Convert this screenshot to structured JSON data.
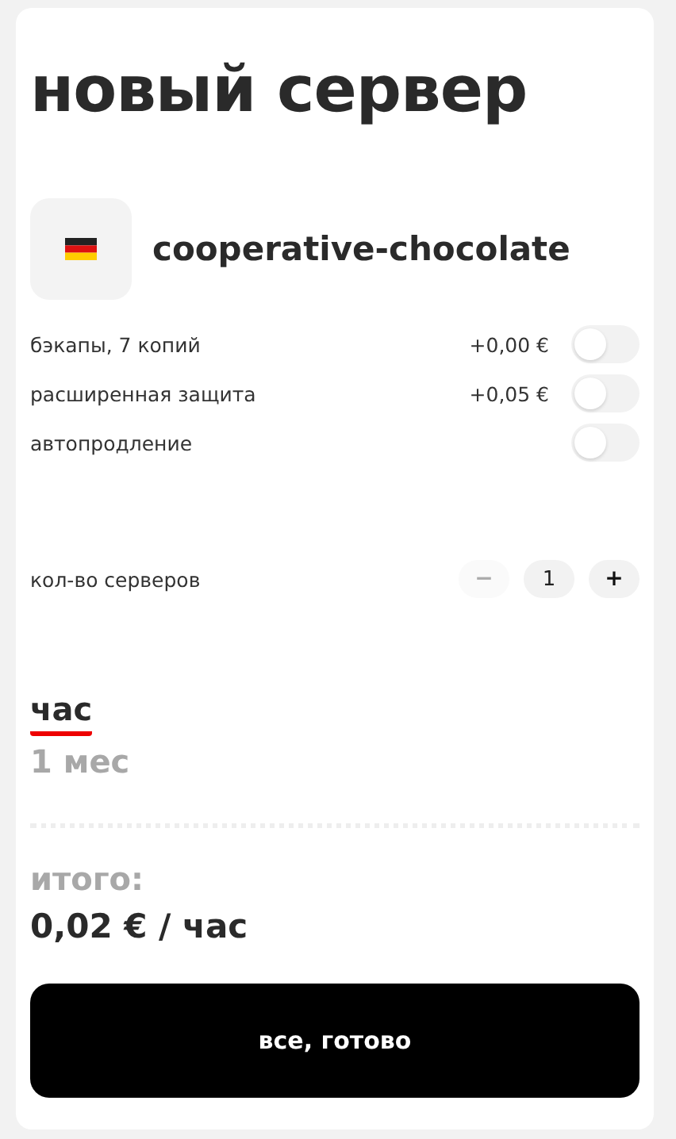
{
  "title": "новый сервер",
  "server": {
    "name": "cooperative-chocolate"
  },
  "options": [
    {
      "label": "бэкапы, 7 копий",
      "price": "+0,00 €",
      "on": false
    },
    {
      "label": "расширенная защита",
      "price": "+0,05 €",
      "on": false
    },
    {
      "label": "автопродление",
      "on": false
    }
  ],
  "quantity": {
    "label": "кол-во серверов",
    "minus": "−",
    "value": "1",
    "plus": "+",
    "minus_disabled": true
  },
  "periods": [
    {
      "label": "час",
      "selected": true
    },
    {
      "label": "1 мес",
      "selected": false
    }
  ],
  "total": {
    "label": "итого:",
    "value": "0,02 € / час"
  },
  "submit": "все, готово"
}
